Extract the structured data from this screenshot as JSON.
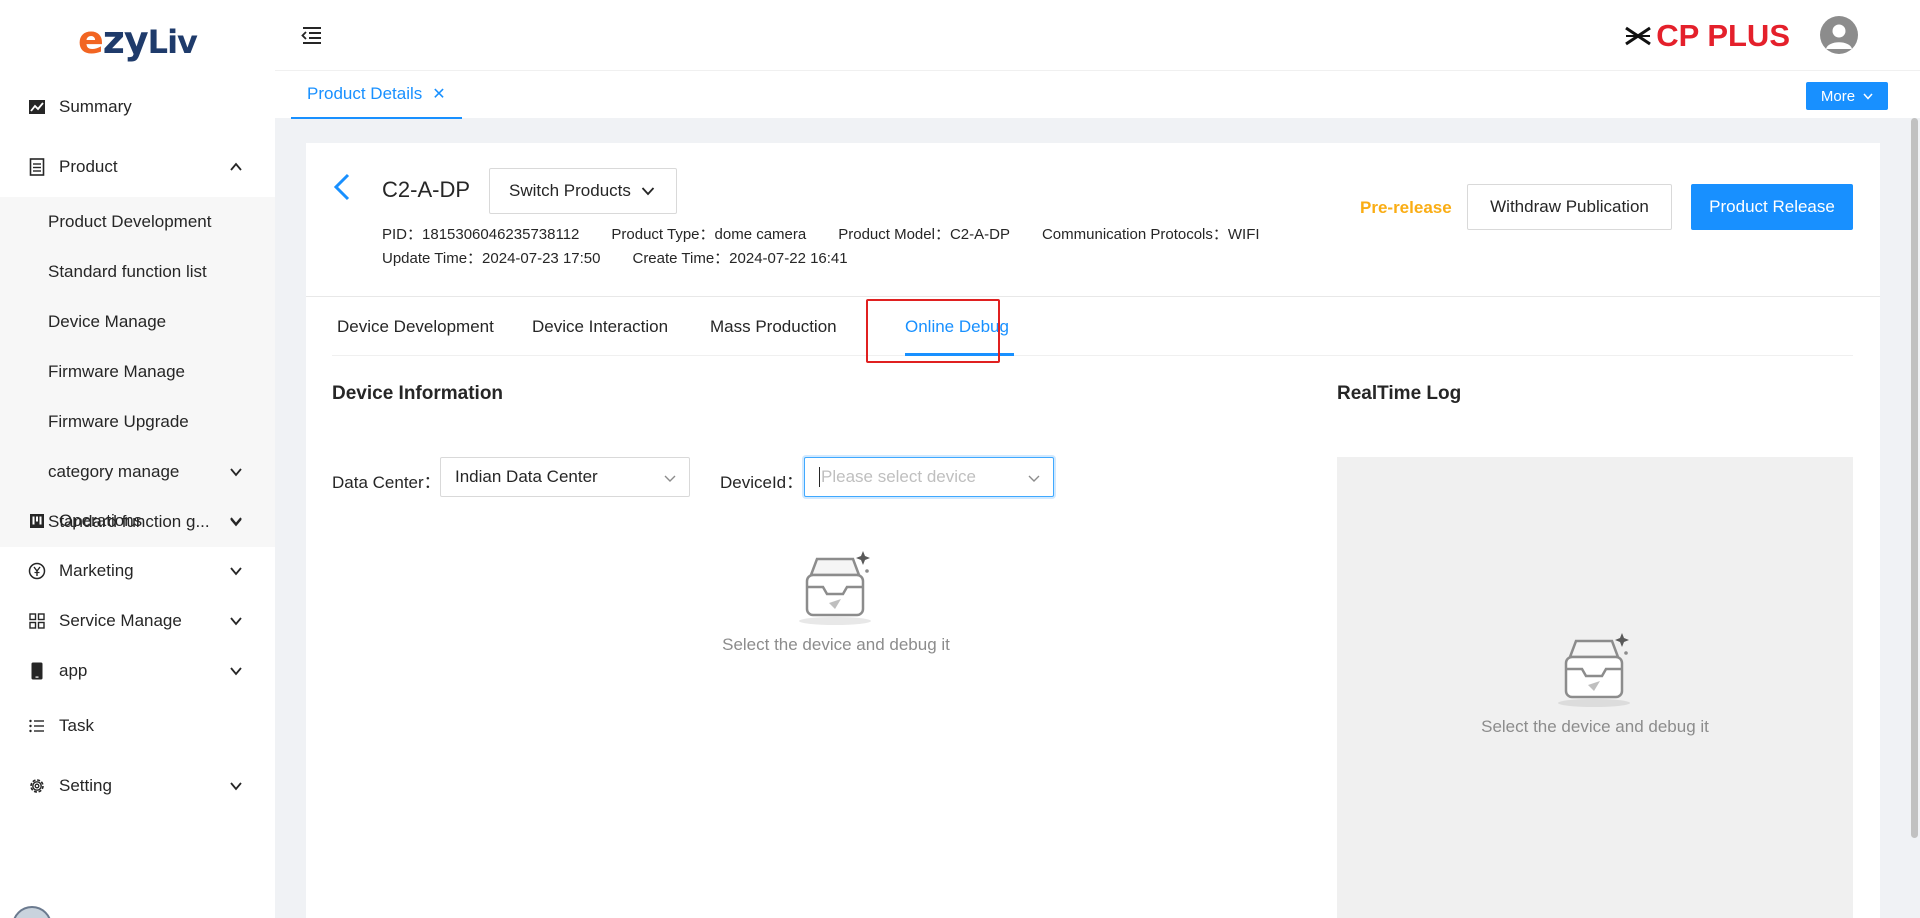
{
  "app": {
    "logo_text": "ezyLiv",
    "brand": "CP PLUS"
  },
  "sidebar": {
    "items": [
      {
        "label": "Summary",
        "icon": "chart-line-icon"
      },
      {
        "label": "Product",
        "icon": "document-icon",
        "expanded": true
      },
      {
        "label": "Operations",
        "icon": "kanban-icon"
      },
      {
        "label": "Marketing",
        "icon": "yen-circle-icon"
      },
      {
        "label": "Service Manage",
        "icon": "grid-icon"
      },
      {
        "label": "app",
        "icon": "mobile-icon"
      },
      {
        "label": "Task",
        "icon": "list-icon"
      },
      {
        "label": "Setting",
        "icon": "gear-icon"
      }
    ],
    "product_sub": [
      "Product Development",
      "Standard function list",
      "Device Manage",
      "Firmware Manage",
      "Firmware Upgrade",
      "category manage",
      "Standard function g..."
    ]
  },
  "tabs": {
    "page_tab": "Product Details",
    "close": "✕",
    "more": "More"
  },
  "product": {
    "name": "C2-A-DP",
    "switch_label": "Switch Products",
    "pid": "PID：1815306046235738112",
    "type": "Product Type：dome camera",
    "model": "Product Model：C2-A-DP",
    "protocols": "Communication Protocols：WIFI",
    "update_time": "Update Time：2024-07-23 17:50",
    "create_time": "Create Time：2024-07-22 16:41",
    "status": "Pre-release",
    "withdraw": "Withdraw Publication",
    "release": "Product Release"
  },
  "content_tabs": [
    "Device Development",
    "Device Interaction",
    "Mass Production",
    "Online Debug"
  ],
  "active_tab": "Online Debug",
  "debug": {
    "device_info_title": "Device Information",
    "data_center_label": "Data Center：",
    "data_center_value": "Indian Data Center",
    "device_id_label": "DeviceId：",
    "device_id_placeholder": "Please select device",
    "empty_text": "Select the device and debug it",
    "log_title": "RealTime Log",
    "log_empty_text": "Select the device and debug it"
  },
  "colors": {
    "primary": "#1890ff",
    "warning": "#faad14",
    "brand": "#e4202b",
    "highlight": "#e02020"
  }
}
